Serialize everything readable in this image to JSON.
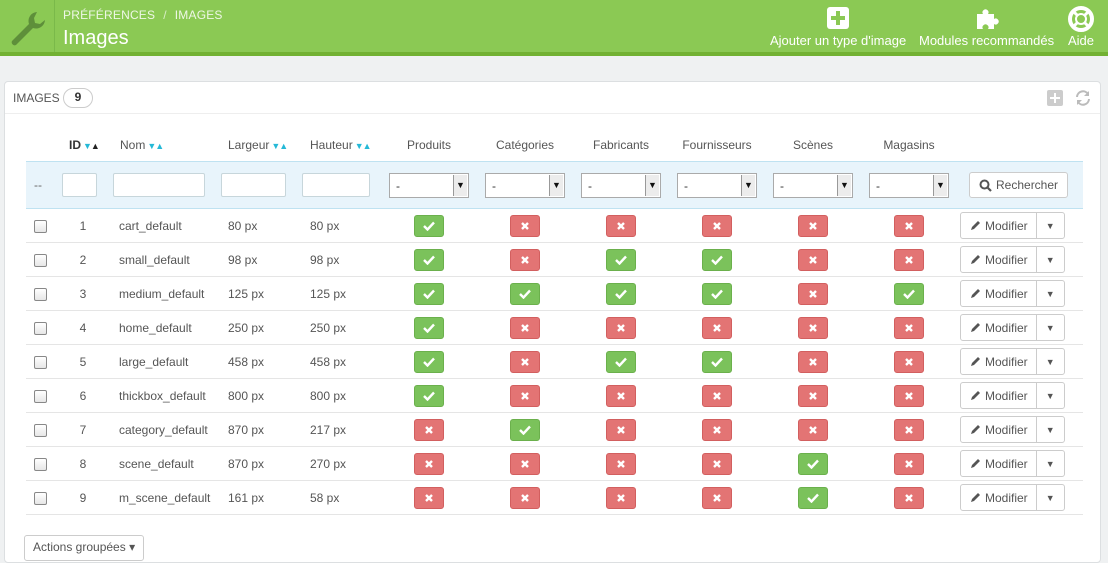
{
  "header": {
    "breadcrumb": [
      "PRÉFÉRENCES",
      "IMAGES"
    ],
    "breadcrumb_sep": "/",
    "title": "Images",
    "toolbar": [
      {
        "label": "Ajouter un type d'image",
        "icon": "plus-square-icon"
      },
      {
        "label": "Modules recommandés",
        "icon": "puzzle-icon"
      },
      {
        "label": "Aide",
        "icon": "lifebuoy-icon"
      }
    ],
    "colors": {
      "bar": "#8bc954",
      "bar_border": "#72b133"
    }
  },
  "panel": {
    "title": "IMAGES",
    "count": "9"
  },
  "table": {
    "columns": [
      "ID",
      "Nom",
      "Largeur",
      "Hauteur",
      "Produits",
      "Catégories",
      "Fabricants",
      "Fournisseurs",
      "Scènes",
      "Magasins"
    ],
    "filter_placeholder": "--",
    "select_default": "-",
    "search_label": "Rechercher",
    "edit_label": "Modifier",
    "rows": [
      {
        "id": "1",
        "name": "cart_default",
        "width": "80 px",
        "height": "80 px",
        "flags": [
          true,
          false,
          false,
          false,
          false,
          false
        ]
      },
      {
        "id": "2",
        "name": "small_default",
        "width": "98 px",
        "height": "98 px",
        "flags": [
          true,
          false,
          true,
          true,
          false,
          false
        ]
      },
      {
        "id": "3",
        "name": "medium_default",
        "width": "125 px",
        "height": "125 px",
        "flags": [
          true,
          true,
          true,
          true,
          false,
          true
        ]
      },
      {
        "id": "4",
        "name": "home_default",
        "width": "250 px",
        "height": "250 px",
        "flags": [
          true,
          false,
          false,
          false,
          false,
          false
        ]
      },
      {
        "id": "5",
        "name": "large_default",
        "width": "458 px",
        "height": "458 px",
        "flags": [
          true,
          false,
          true,
          true,
          false,
          false
        ]
      },
      {
        "id": "6",
        "name": "thickbox_default",
        "width": "800 px",
        "height": "800 px",
        "flags": [
          true,
          false,
          false,
          false,
          false,
          false
        ]
      },
      {
        "id": "7",
        "name": "category_default",
        "width": "870 px",
        "height": "217 px",
        "flags": [
          false,
          true,
          false,
          false,
          false,
          false
        ]
      },
      {
        "id": "8",
        "name": "scene_default",
        "width": "870 px",
        "height": "270 px",
        "flags": [
          false,
          false,
          false,
          false,
          true,
          false
        ]
      },
      {
        "id": "9",
        "name": "m_scene_default",
        "width": "161 px",
        "height": "58 px",
        "flags": [
          false,
          false,
          false,
          false,
          true,
          false
        ]
      }
    ],
    "colors": {
      "yes": "#7bc25b",
      "no": "#e37474"
    }
  },
  "bulk_actions": "Actions groupées"
}
